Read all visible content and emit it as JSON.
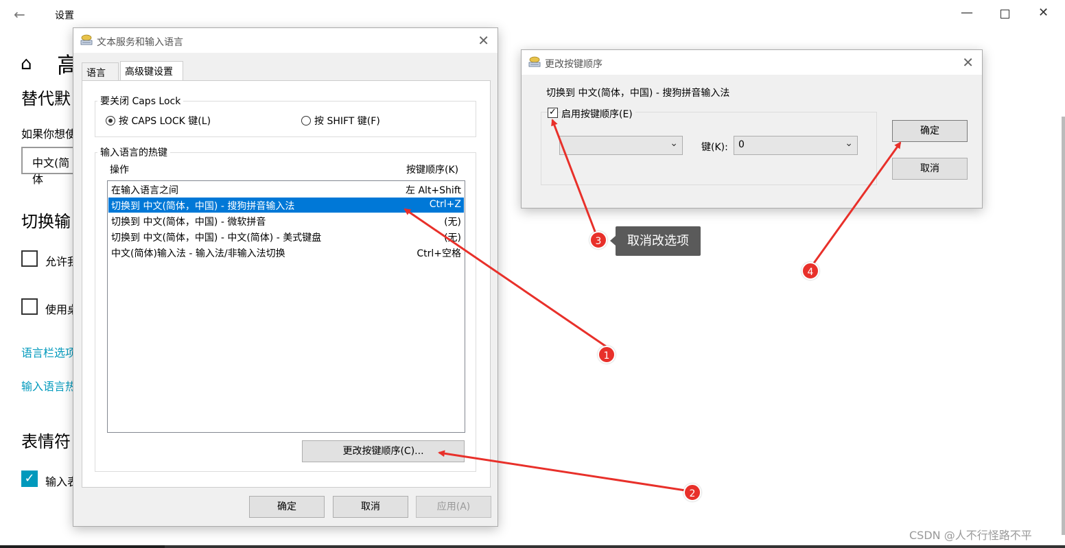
{
  "settings": {
    "title": "设置",
    "heading_partial": "高",
    "section1_title": "替代默",
    "section1_desc": "如果你想使",
    "dropdown_value": "中文(简体",
    "section2_title": "切换输",
    "check1_label": "允许我",
    "check2_label": "使用桌",
    "link1": "语言栏选项",
    "link2": "输入语言热",
    "section3_title": "表情符",
    "check3_label": "输入表"
  },
  "dialog1": {
    "title": "文本服务和输入语言",
    "tabs": [
      "语言栏",
      "高级键设置"
    ],
    "caps_group_label": "要关闭 Caps Lock",
    "radio_caps": "按 CAPS LOCK 键(L)",
    "radio_shift": "按 SHIFT 键(F)",
    "hotkey_group_label": "输入语言的热键",
    "col_action": "操作",
    "col_key": "按键顺序(K)",
    "rows": [
      {
        "action": "在输入语言之间",
        "key": "左 Alt+Shift"
      },
      {
        "action": "切换到 中文(简体，中国) - 搜狗拼音输入法",
        "key": "Ctrl+Z"
      },
      {
        "action": "切换到 中文(简体，中国) - 微软拼音",
        "key": "(无)"
      },
      {
        "action": "切换到 中文(简体，中国) - 中文(简体) - 美式键盘",
        "key": "(无)"
      },
      {
        "action": "中文(简体)输入法 - 输入法/非输入法切换",
        "key": "Ctrl+空格"
      }
    ],
    "change_btn": "更改按键顺序(C)...",
    "ok": "确定",
    "cancel": "取消",
    "apply": "应用(A)"
  },
  "dialog2": {
    "title": "更改按键顺序",
    "subtitle": "切换到 中文(简体，中国) - 搜狗拼音输入法",
    "enable_label": "启用按键顺序(E)",
    "combo1_value": "",
    "key_label": "键(K):",
    "combo2_value": "0",
    "ok": "确定",
    "cancel": "取消"
  },
  "annotations": {
    "badge1": "1",
    "badge2": "2",
    "badge3": "3",
    "badge4": "4",
    "callout": "取消改选项",
    "arrow_color": "#e8302a"
  },
  "watermark": "CSDN @人不行怪路不平"
}
